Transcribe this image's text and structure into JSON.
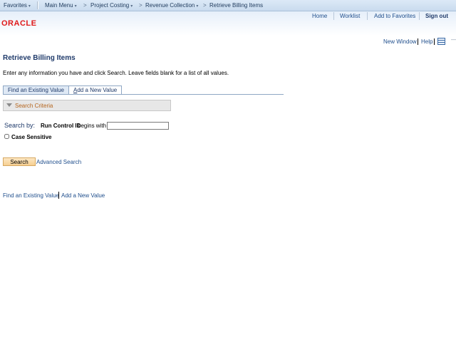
{
  "breadcrumbs": {
    "favorites": "Favorites",
    "main_menu": "Main Menu",
    "project_costing": "Project Costing",
    "revenue_collection": "Revenue Collection",
    "current": "Retrieve Billing Items",
    "chevron": ">",
    "dropdown_arrow": "▾"
  },
  "header": {
    "logo": "ORACLE",
    "links": {
      "home": "Home",
      "worklist": "Worklist",
      "add_to_favorites": "Add to Favorites",
      "sign_out": "Sign out"
    }
  },
  "subheader": {
    "new_window": "New Window",
    "help": "Help",
    "layout_icon": "layout-grid-icon",
    "more": "—"
  },
  "page": {
    "title": "Retrieve Billing Items",
    "instructions": "Enter any information you have and click Search. Leave fields blank for a list of all values."
  },
  "tabs": {
    "find_existing": "Find an Existing Value",
    "add_new_prefix": "A",
    "add_new_rest": "dd a New Value"
  },
  "criteria": {
    "label": "Search Criteria"
  },
  "search": {
    "search_by": "Search by:",
    "field_label": "Run Control ID",
    "operator": "begins with",
    "value": "",
    "case_sensitive": "Case Sensitive",
    "button": "Search",
    "advanced": "Advanced Search"
  },
  "footer": {
    "find_existing": "Find an Existing Value",
    "add_new": "Add a New Value"
  },
  "colors": {
    "link": "#1f4e8c",
    "oracle_red": "#e01a1a",
    "criteria_text": "#b5651d",
    "search_button": "#f6cf92"
  }
}
